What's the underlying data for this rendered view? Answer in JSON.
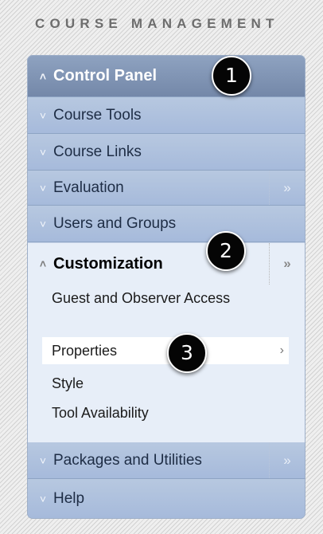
{
  "header": {
    "title": "COURSE MANAGEMENT"
  },
  "menu": {
    "control_panel": "Control Panel",
    "course_tools": "Course Tools",
    "course_links": "Course Links",
    "evaluation": "Evaluation",
    "users_groups": "Users and Groups",
    "customization": "Customization",
    "sub_items": [
      "Guest and Observer Access",
      "Properties",
      "Style",
      "Tool Availability"
    ],
    "packages": "Packages and Utilities",
    "help": "Help"
  },
  "glyphs": {
    "collapse": "˄",
    "expand": "˅",
    "double_right": "»",
    "right": "›"
  },
  "badges": [
    "1",
    "2",
    "3"
  ],
  "colors": {
    "panel_dark": "#7a8eb0",
    "panel_light": "#a5b9d6",
    "open_section": "#e7eef8"
  }
}
